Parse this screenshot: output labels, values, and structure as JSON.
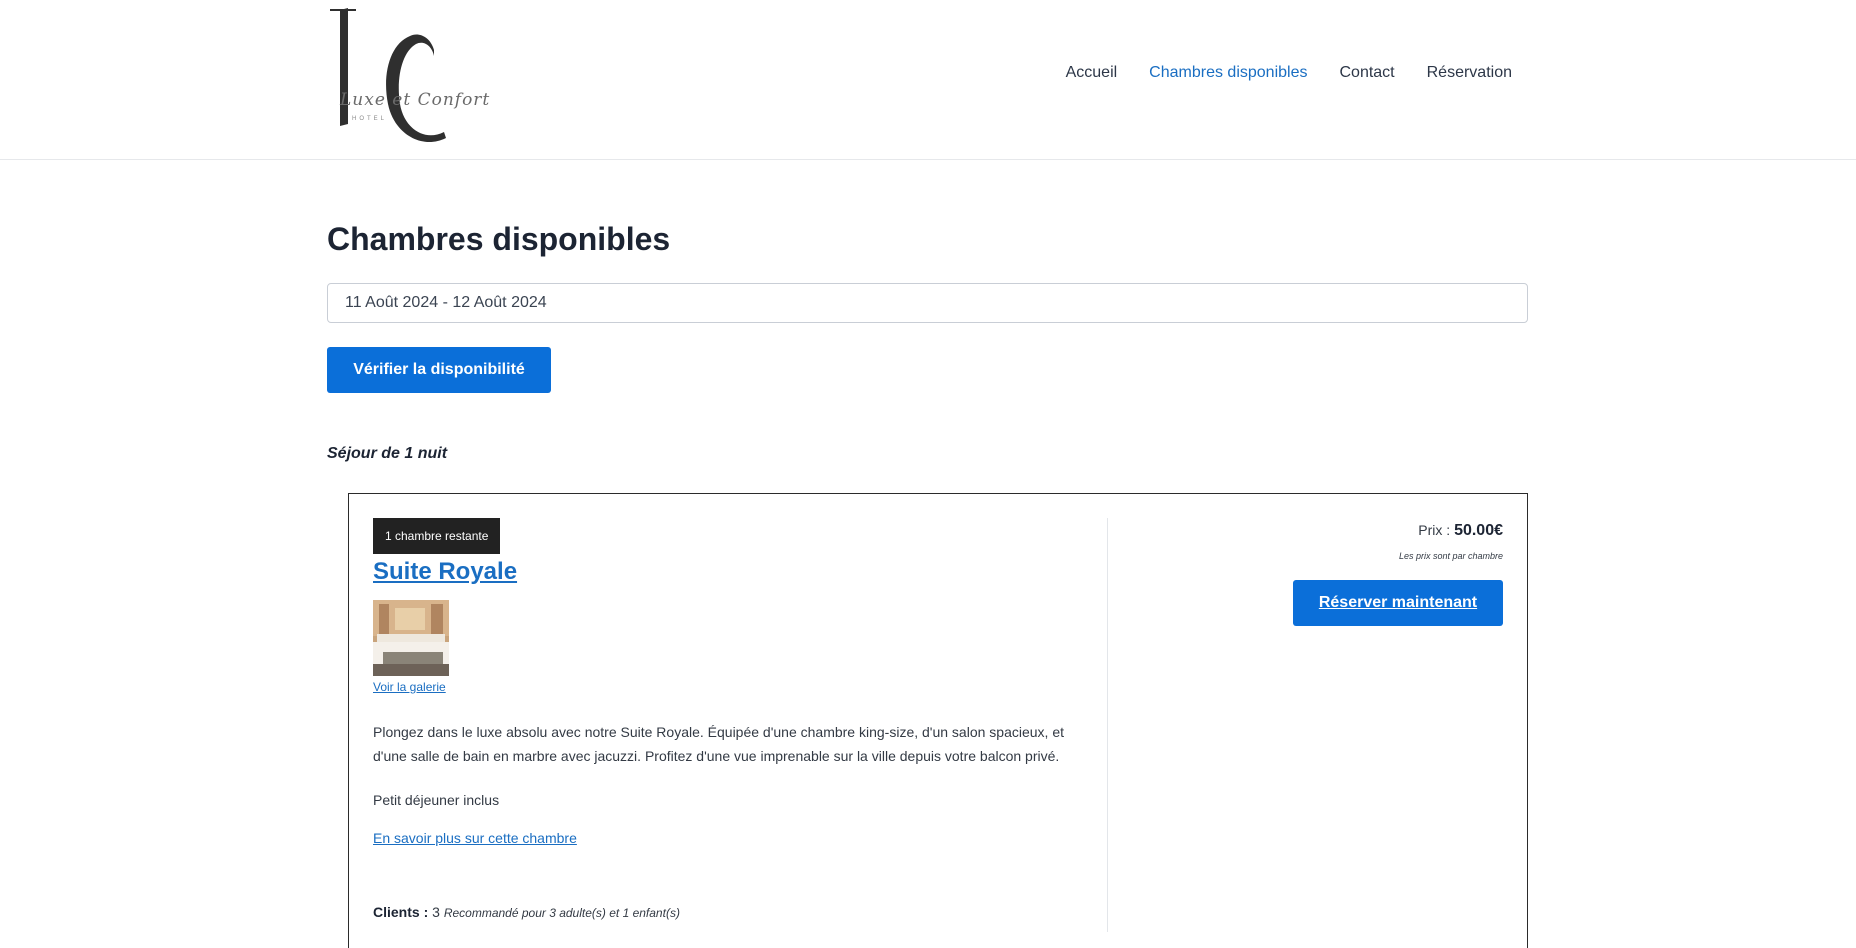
{
  "header": {
    "logo": {
      "monogram": "LC",
      "script": "Luxe et Confort",
      "small": "HOTEL"
    },
    "nav": [
      {
        "label": "Accueil",
        "active": false
      },
      {
        "label": "Chambres disponibles",
        "active": true
      },
      {
        "label": "Contact",
        "active": false
      },
      {
        "label": "Réservation",
        "active": false
      }
    ]
  },
  "main": {
    "title": "Chambres disponibles",
    "date_range": "11 Août 2024 - 12 Août 2024",
    "check_button": "Vérifier la disponibilité",
    "stay_label": "Séjour de 1 nuit"
  },
  "room": {
    "badge": "1 chambre restante",
    "name": "Suite Royale",
    "gallery_link": "Voir la galerie",
    "description": "Plongez dans le luxe absolu avec notre Suite Royale. Équipée d'une chambre king-size, d'un salon spacieux, et d'une salle de bain en marbre avec jacuzzi. Profitez d'une vue imprenable sur la ville depuis votre balcon privé.",
    "breakfast": "Petit déjeuner inclus",
    "more_link": "En savoir plus sur cette chambre",
    "clients_label": "Clients :",
    "clients_value": "3",
    "clients_note": "Recommandé pour 3 adulte(s) et 1 enfant(s)",
    "price_label": "Prix :",
    "price_value": "50.00€",
    "price_note": "Les prix sont par chambre",
    "book_button": "Réserver maintenant"
  },
  "colors": {
    "accent": "#0b6fd9",
    "link": "#1a6ec2",
    "badge": "#222222"
  }
}
